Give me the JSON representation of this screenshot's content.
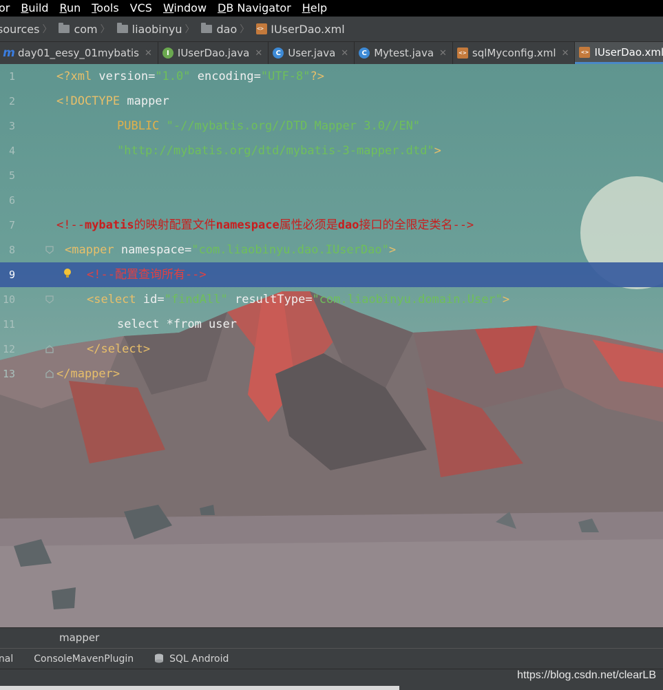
{
  "menu": [
    "or",
    "Build",
    "Run",
    "Tools",
    "VCS",
    "Window",
    "DB Navigator",
    "Help"
  ],
  "menu_mnemonics": [
    "",
    "B",
    "R",
    "T",
    "",
    "W",
    "D",
    "H"
  ],
  "breadcrumb": [
    "sources",
    "com",
    "liaobinyu",
    "dao",
    "IUserDao.xml"
  ],
  "tabs": [
    {
      "label": "day01_eesy_01mybatis",
      "icon": "m-icon",
      "closable": true
    },
    {
      "label": "IUserDao.java",
      "icon": "interface-icon",
      "closable": true
    },
    {
      "label": "User.java",
      "icon": "class-icon",
      "closable": true
    },
    {
      "label": "Mytest.java",
      "icon": "class-icon",
      "closable": true
    },
    {
      "label": "sqlMyconfig.xml",
      "icon": "xml-file-icon",
      "closable": true
    },
    {
      "label": "IUserDao.xml",
      "icon": "xml-file-icon",
      "closable": false,
      "active": true
    }
  ],
  "editor": {
    "line_numbers": [
      "1",
      "2",
      "3",
      "4",
      "5",
      "6",
      "7",
      "8",
      "9",
      "10",
      "11",
      "12",
      "13"
    ],
    "lines": [
      {
        "t1": "<?xml ",
        "t2": "version=",
        "t3": "\"1.0\"",
        "t4": " encoding=",
        "t5": "\"UTF-8\"",
        "t6": "?>"
      },
      {
        "t1": "<!DOCTYPE ",
        "t2": "mapper"
      },
      {
        "t1": "PUBLIC ",
        "t2": "\"-//mybatis.org//DTD Mapper 3.0//EN\""
      },
      {
        "t1": "\"http://mybatis.org/dtd/mybatis-3-mapper.dtd\"",
        "t2": ">"
      },
      {},
      {},
      {
        "t1": "<!--",
        "t2": "mybatis",
        "t3": "的映射配置文件",
        "t4": "namespace",
        "t5": "属性必须是",
        "t6": "dao",
        "t7": "接口的全限定类名",
        "t8": "-->"
      },
      {
        "t1": "<mapper ",
        "t2": "namespace=",
        "t3": "\"com.liaobinyu.dao.IUserDao\"",
        "t4": ">"
      },
      {
        "t1": "<!--配置查询所有-->"
      },
      {
        "t1": "<select ",
        "t2": "id=",
        "t3": "\"findAll\"",
        "t4": " resultType=",
        "t5": "\"com.liaobinyu.domain.User\"",
        "t6": ">"
      },
      {
        "t1": "select *from user"
      },
      {
        "t1": "</select>"
      },
      {
        "t1": "</mapper>"
      }
    ],
    "highlighted_line": "9"
  },
  "structure_crumb": "mapper",
  "tool_windows": [
    "inal",
    "ConsoleMavenPlugin",
    "SQL Android"
  ],
  "watermark": "https://blog.csdn.net/clearLB",
  "colors": {
    "accent": "#4a88c7",
    "highlight_line": "#3a5c9e",
    "comment": "#c81e1e",
    "string": "#6fbf5a",
    "tag": "#e8bf6a"
  }
}
